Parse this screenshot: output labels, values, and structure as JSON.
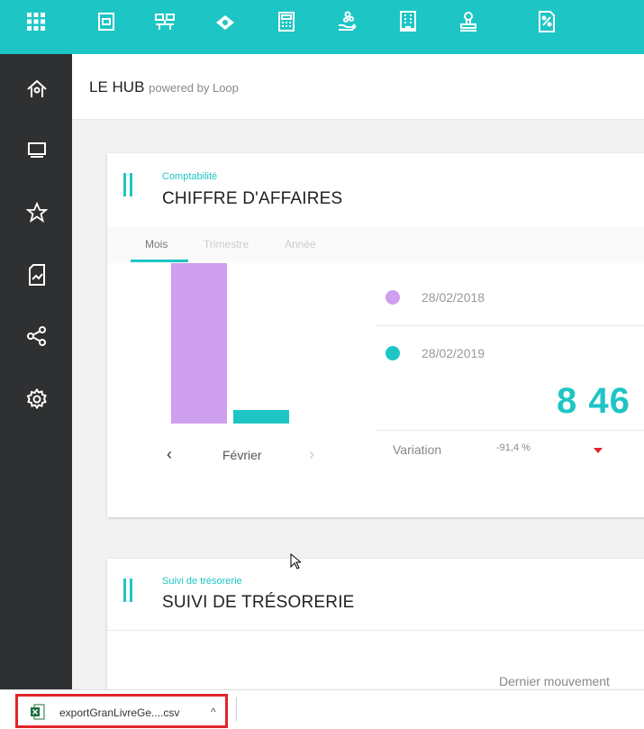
{
  "topbar": {
    "icons": [
      "apps-grid-icon",
      "wallet-icon",
      "org-chart-icon",
      "banknotes-icon",
      "calculator-icon",
      "hand-coins-icon",
      "building-icon",
      "stamp-icon",
      "percent-document-icon"
    ]
  },
  "sidebar": {
    "icons": [
      "home-icon",
      "screens-icon",
      "star-icon",
      "report-chart-icon",
      "share-icon",
      "settings-icon"
    ]
  },
  "header": {
    "brand": "LE HUB",
    "tagline": "powered by Loop"
  },
  "card1": {
    "kicker": "Comptabilité",
    "title": "CHIFFRE D'AFFAIRES",
    "tabs": [
      "Mois",
      "Trimestre",
      "Année"
    ],
    "month": "Février",
    "legend": [
      {
        "date": "28/02/2018",
        "color": "#cf9ff0"
      },
      {
        "date": "28/02/2019",
        "color": "#1ec5c5"
      }
    ],
    "big_value": "8 46",
    "variation_label": "Variation",
    "variation_value": "-91,4 %",
    "colors": {
      "accent": "#1ec5c5",
      "down": "#e0242b"
    }
  },
  "chart_data": {
    "type": "bar",
    "categories": [
      "28/02/2018",
      "28/02/2019"
    ],
    "values": [
      100,
      8.6
    ],
    "title": "",
    "xlabel": "",
    "ylabel": ""
  },
  "card2": {
    "kicker": "Suivi de trésorerie",
    "title": "SUIVI DE TRÉSORERIE",
    "last_move_label": "Dernier mouvement"
  },
  "download": {
    "filename": "exportGranLivreGe....csv"
  }
}
